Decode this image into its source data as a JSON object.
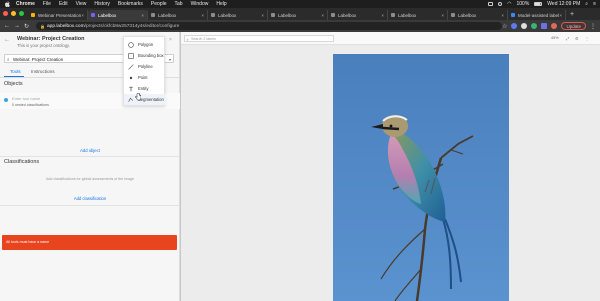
{
  "menubar": {
    "items": [
      "Chrome",
      "File",
      "Edit",
      "View",
      "History",
      "Bookmarks",
      "People",
      "Tab",
      "Window",
      "Help"
    ],
    "datetime": "Wed 12:09 PM",
    "battery": "100%"
  },
  "browser": {
    "tabs": [
      {
        "label": "Webinar Presentation",
        "active": false,
        "favicon": "slides-icon"
      },
      {
        "label": "Labelbox",
        "active": true,
        "favicon": "labelbox-icon"
      },
      {
        "label": "Labelbox",
        "active": false,
        "favicon": "labelbox-icon"
      },
      {
        "label": "Labelbox",
        "active": false,
        "favicon": "labelbox-icon"
      },
      {
        "label": "Labelbox",
        "active": false,
        "favicon": "labelbox-icon"
      },
      {
        "label": "Labelbox",
        "active": false,
        "favicon": "labelbox-icon"
      },
      {
        "label": "Labelbox",
        "active": false,
        "favicon": "labelbox-icon"
      },
      {
        "label": "Labelbox",
        "active": false,
        "favicon": "labelbox-icon"
      },
      {
        "label": "Model-assisted label",
        "active": false,
        "favicon": "doc-icon"
      }
    ],
    "url_domain": "app.labelbox.com",
    "url_path": "/projects/ckfcb8w257314y4s/editor/configure",
    "update_label": "Update"
  },
  "left_panel": {
    "project_title": "Webinar: Project Creation",
    "project_subtitle": "This is your project ontology.",
    "project_select_value": "Webinar: Project Creation",
    "tabs": {
      "tools": "Tools",
      "instructions": "Instructions"
    },
    "objects_title": "Objects",
    "object_name_placeholder": "Enter tool name",
    "object_subtext": "0 nested classifications",
    "add_object": "Add object",
    "classifications_title": "Classifications",
    "classifications_empty": "Add classifications for global assessments of the image",
    "add_classification": "Add classification",
    "error_text": "All tools must have a name"
  },
  "tool_menu": {
    "items": [
      {
        "label": "Polygon",
        "icon": "polygon-icon"
      },
      {
        "label": "Bounding box",
        "icon": "bounding-box-icon"
      },
      {
        "label": "Polyline",
        "icon": "polyline-icon"
      },
      {
        "label": "Point",
        "icon": "point-icon"
      },
      {
        "label": "Entity",
        "icon": "entity-icon"
      },
      {
        "label": "Segmentation",
        "icon": "segmentation-icon"
      }
    ],
    "hovered": "Segmentation"
  },
  "editor": {
    "search_placeholder": "Search 2 labels",
    "zoom": "45%",
    "image_subject": "lilac-breasted roller bird on branch"
  },
  "colors": {
    "accent": "#1a73e8",
    "error": "#e8441e",
    "sky": "#4f86c3"
  }
}
